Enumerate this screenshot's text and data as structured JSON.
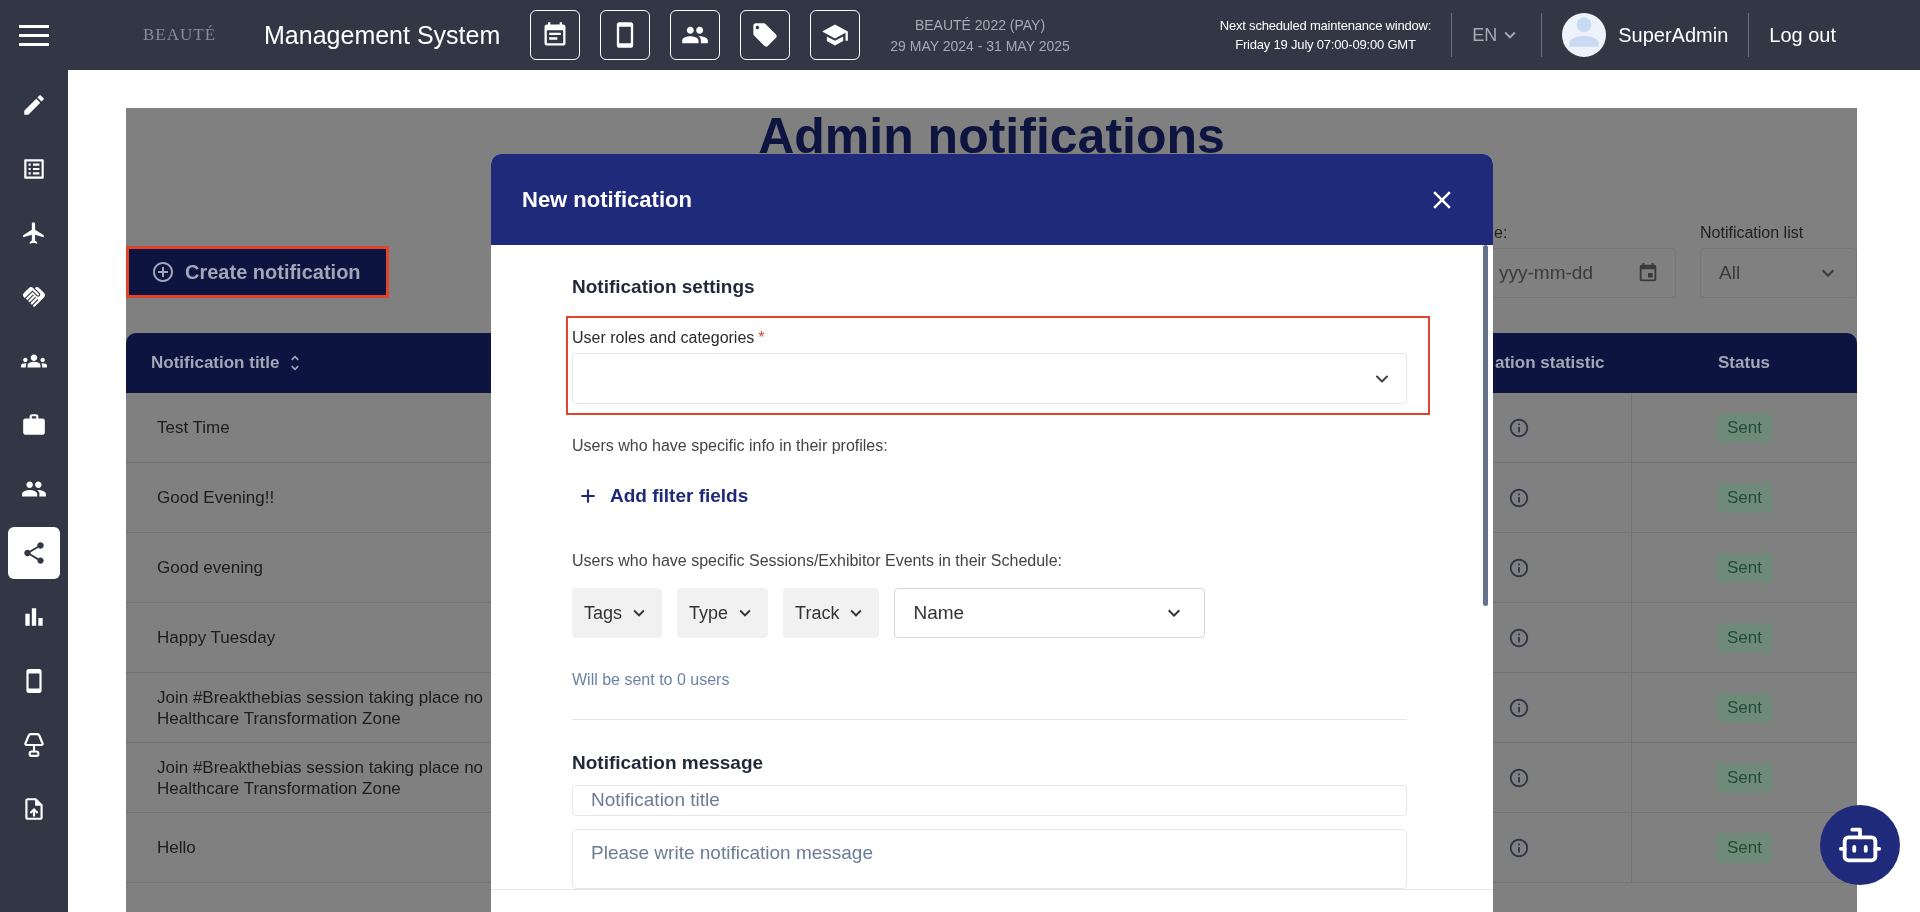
{
  "topbar": {
    "logo": "BEAUTÉ",
    "app_title": "Management System",
    "event_name": "BEAUTÉ 2022 (PAY)",
    "event_dates": "29 MAY 2024 - 31 MAY 2025",
    "maintenance": [
      "Next scheduled maintenance window:",
      "Friday 19 July 07:00-09:00 GMT"
    ],
    "language": "EN",
    "user": "SuperAdmin",
    "logout": "Log out"
  },
  "sidebar": {
    "items": [
      {
        "selected": false
      },
      {
        "selected": false
      },
      {
        "selected": false
      },
      {
        "selected": false
      },
      {
        "selected": false
      },
      {
        "selected": false
      },
      {
        "selected": false
      },
      {
        "selected": true
      },
      {
        "selected": false
      },
      {
        "selected": false
      },
      {
        "selected": false
      },
      {
        "selected": false
      }
    ]
  },
  "page": {
    "title": "Admin notifications",
    "create_button": "Create notification",
    "date_filter": {
      "label": "e:",
      "placeholder": "yyy-mm-dd"
    },
    "list_filter": {
      "label": "Notification list",
      "value": "All"
    }
  },
  "table": {
    "columns": [
      "Notification title",
      "ation statistic",
      "Status"
    ],
    "rows": [
      {
        "title": "Test Time",
        "status": "Sent"
      },
      {
        "title": "Good Evening!!",
        "status": "Sent"
      },
      {
        "title": "Good evening",
        "status": "Sent"
      },
      {
        "title": "Happy Tuesday",
        "status": "Sent"
      },
      {
        "title": "Join #Breakthebias session taking place no\nHealthcare Transformation Zone",
        "status": "Sent"
      },
      {
        "title": "Join #Breakthebias session taking place no\nHealthcare Transformation Zone",
        "status": "Sent"
      },
      {
        "title": "Hello",
        "status": "Sent"
      }
    ]
  },
  "modal": {
    "title": "New notification",
    "settings_heading": "Notification settings",
    "roles_label": "User roles and categories",
    "required_mark": "*",
    "profile_text": "Users who have specific info in their profiles:",
    "add_filter": "Add filter fields",
    "schedule_text": "Users who have specific Sessions/Exhibitor Events in their Schedule:",
    "filters": [
      "Tags",
      "Type",
      "Track"
    ],
    "name_select": "Name",
    "recipients": "Will be sent to 0 users",
    "message_heading": "Notification message",
    "title_placeholder": "Notification title",
    "message_placeholder": "Please write notification message"
  }
}
